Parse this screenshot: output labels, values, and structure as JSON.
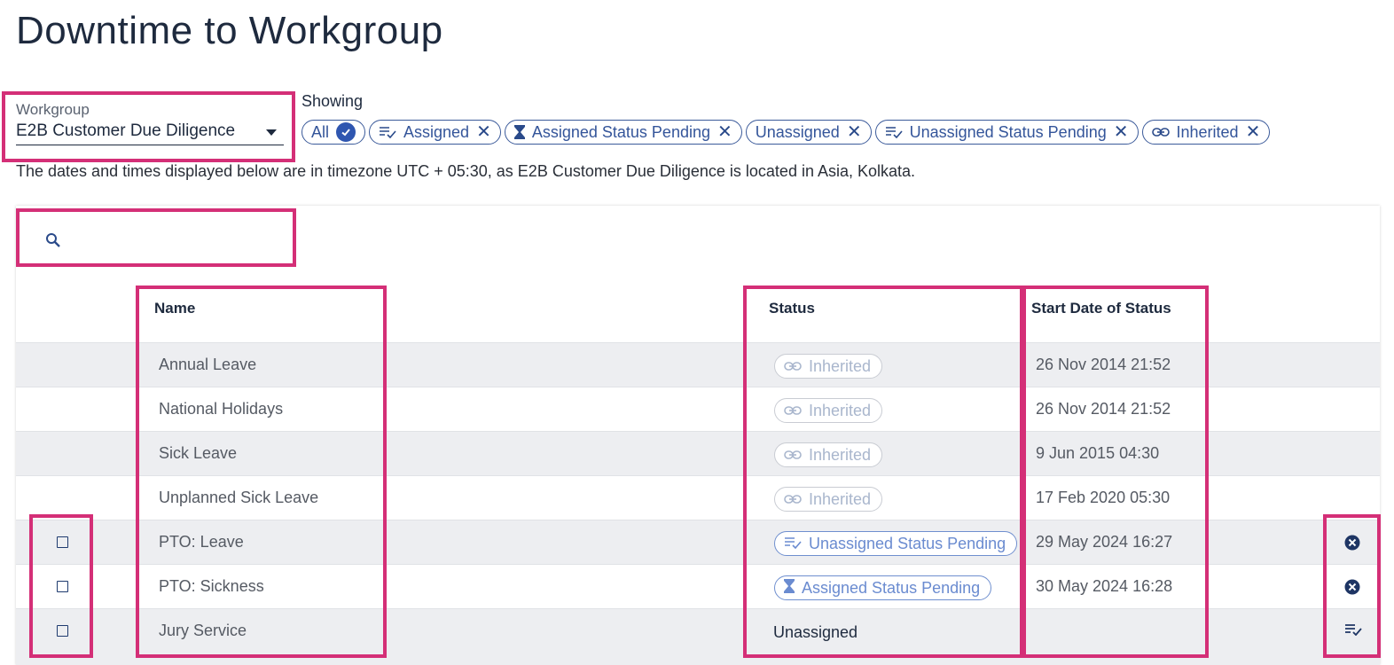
{
  "page": {
    "title": "Downtime to Workgroup"
  },
  "workgroup": {
    "label": "Workgroup",
    "value": "E2B Customer Due Diligence"
  },
  "filters": {
    "label": "Showing",
    "chips": [
      {
        "label": "All",
        "icon": "check-circle-icon"
      },
      {
        "label": "Assigned",
        "icon": "list-check-icon",
        "remove": "✕"
      },
      {
        "label": "Assigned Status Pending",
        "icon": "hourglass-icon",
        "remove": "✕"
      },
      {
        "label": "Unassigned",
        "remove": "✕"
      },
      {
        "label": "Unassigned Status Pending",
        "icon": "list-check-icon",
        "remove": "✕"
      },
      {
        "label": "Inherited",
        "icon": "link-icon",
        "remove": "✕"
      }
    ]
  },
  "timezone_note": "The dates and times displayed below are in timezone UTC + 05:30, as E2B Customer Due Diligence is located in Asia, Kolkata.",
  "table": {
    "columns": {
      "name": "Name",
      "status": "Status",
      "start_date": "Start Date of Status"
    },
    "rows": [
      {
        "name": "Annual Leave",
        "status": "Inherited",
        "status_icon": "link-icon",
        "start_date": "26 Nov 2014 21:52"
      },
      {
        "name": "National Holidays",
        "status": "Inherited",
        "status_icon": "link-icon",
        "start_date": "26 Nov 2014 21:52"
      },
      {
        "name": "Sick Leave",
        "status": "Inherited",
        "status_icon": "link-icon",
        "start_date": "9 Jun 2015 04:30"
      },
      {
        "name": "Unplanned Sick Leave",
        "status": "Inherited",
        "status_icon": "link-icon",
        "start_date": "17 Feb 2020 05:30"
      },
      {
        "name": "PTO: Leave",
        "status": "Unassigned Status Pending",
        "status_icon": "list-check-icon",
        "start_date": "29 May 2024 16:27",
        "action_icon": "cancel-circle-icon"
      },
      {
        "name": "PTO: Sickness",
        "status": "Assigned Status Pending",
        "status_icon": "hourglass-icon",
        "start_date": "30 May 2024 16:28",
        "action_icon": "cancel-circle-icon"
      },
      {
        "name": "Jury Service",
        "status": "Unassigned",
        "start_date": "",
        "action_icon": "list-check-icon"
      }
    ]
  },
  "colors": {
    "accent": "#2f56b0",
    "highlight": "#d42f77",
    "row_alt": "#edeef1"
  }
}
